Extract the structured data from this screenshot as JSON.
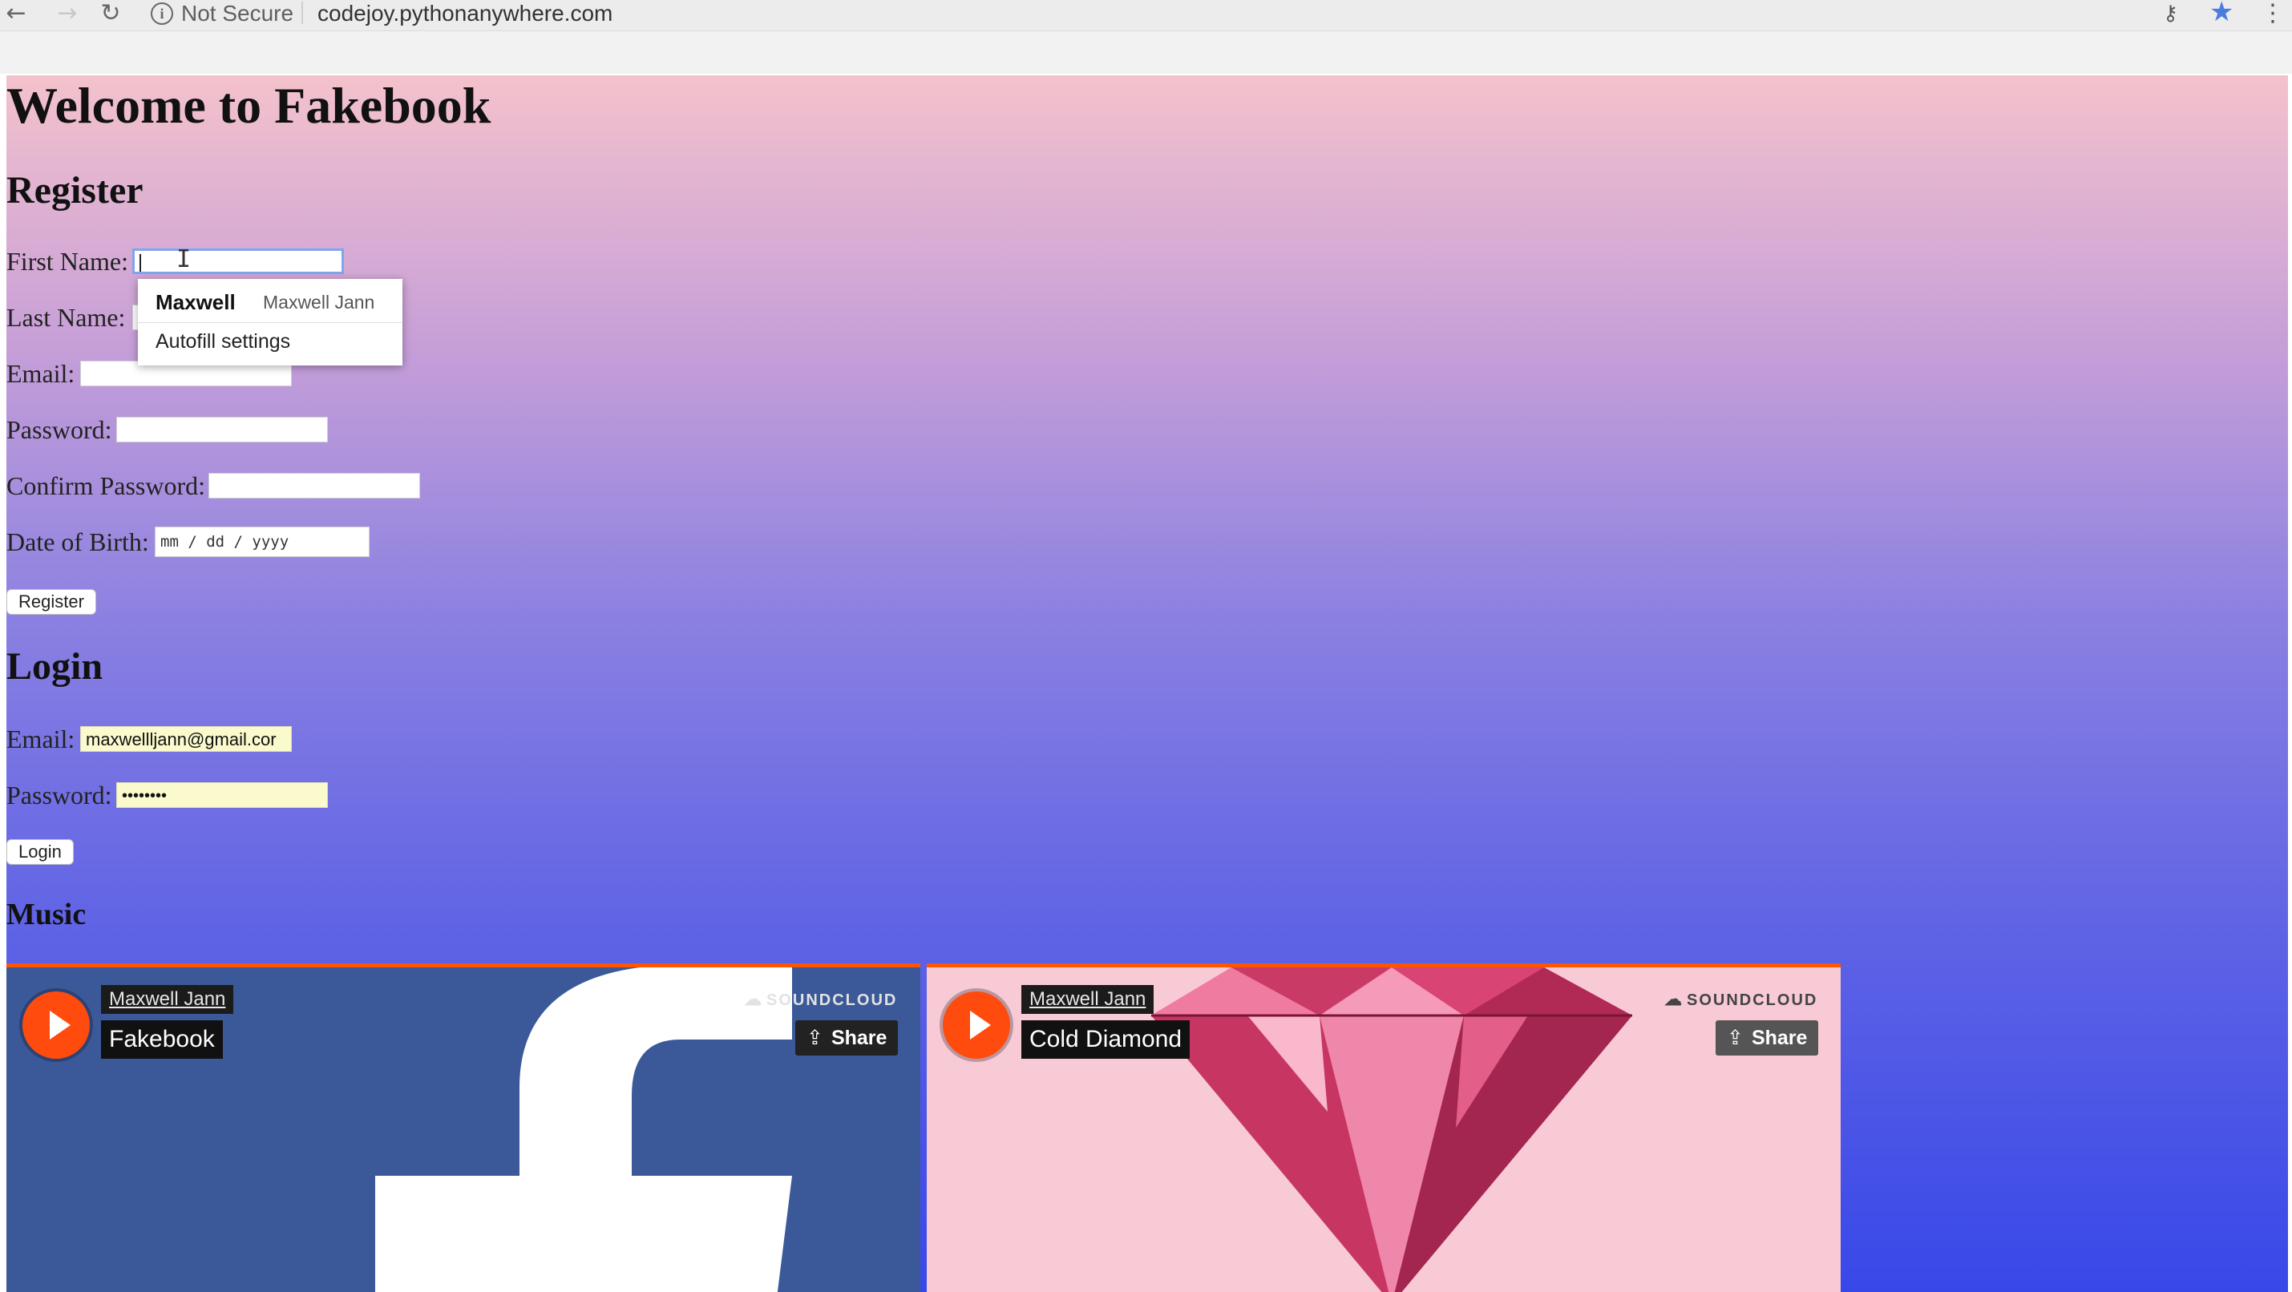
{
  "browser": {
    "back_icon": "←",
    "forward_icon": "→",
    "reload_icon": "↻",
    "security_label": "Not Secure",
    "url": "codejoy.pythonanywhere.com",
    "key_icon": "⚷",
    "star_icon": "★",
    "menu_icon": "⋮"
  },
  "page": {
    "title": "Welcome to Fakebook",
    "register": {
      "heading": "Register",
      "first_name_label": "First Name:",
      "first_name_value": "",
      "last_name_label": "Last Name:",
      "email_label": "Email:",
      "password_label": "Password:",
      "confirm_password_label": "Confirm Password:",
      "dob_label": "Date of Birth:",
      "dob_placeholder": "mm / dd / yyyy",
      "button_label": "Register"
    },
    "autofill": {
      "suggestion_name": "Maxwell",
      "suggestion_full": "Maxwell Jann",
      "settings_label": "Autofill settings"
    },
    "login": {
      "heading": "Login",
      "email_label": "Email:",
      "email_value": "maxwellljann@gmail.cor",
      "password_label": "Password:",
      "password_value": "••••••••",
      "button_label": "Login"
    },
    "music": {
      "heading": "Music",
      "players": [
        {
          "artist": "Maxwell Jann",
          "track": "Fakebook",
          "brand": "SOUNDCLOUD",
          "share_label": "Share"
        },
        {
          "artist": "Maxwell Jann",
          "track": "Cold Diamond",
          "brand": "SOUNDCLOUD",
          "share_label": "Share"
        }
      ]
    }
  },
  "colors": {
    "gradient_top": "#f4c2cc",
    "gradient_bottom": "#3848e8",
    "soundcloud_orange": "#ff5500",
    "facebook_blue": "#3b5998"
  }
}
